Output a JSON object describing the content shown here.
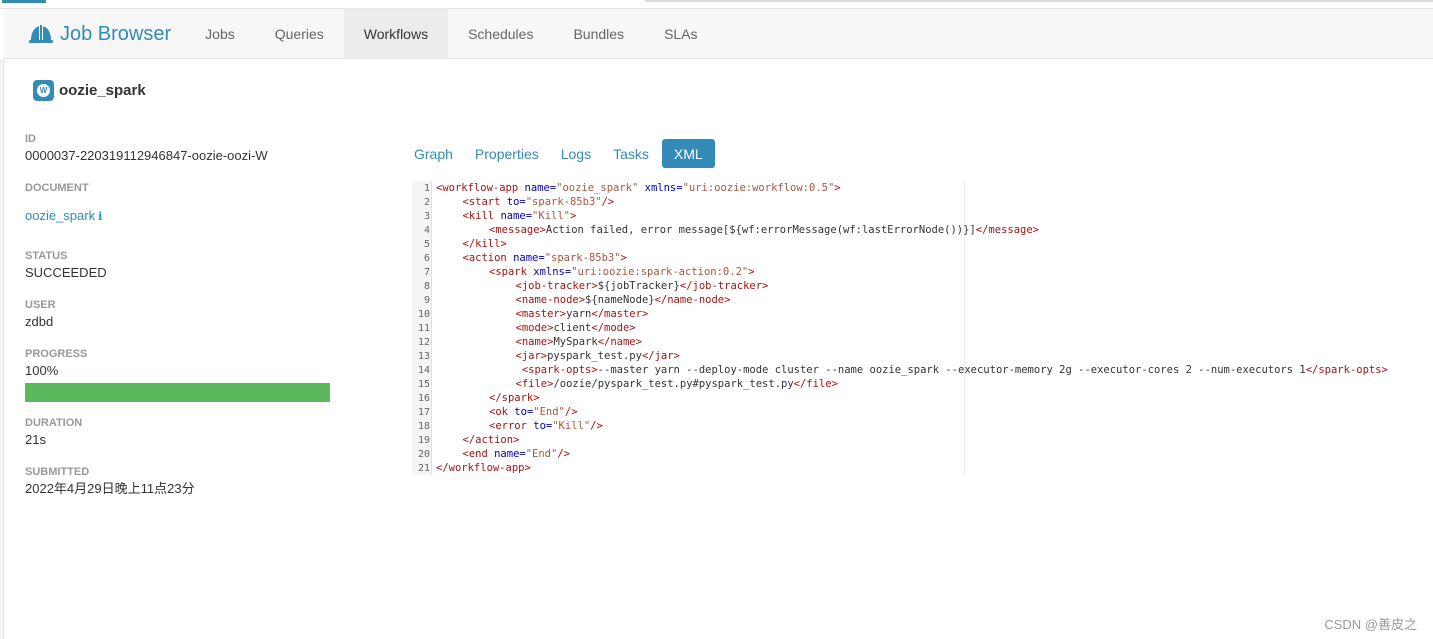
{
  "app": {
    "title": "Job Browser"
  },
  "nav": {
    "tabs": [
      {
        "label": "Jobs"
      },
      {
        "label": "Queries"
      },
      {
        "label": "Workflows",
        "active": true
      },
      {
        "label": "Schedules"
      },
      {
        "label": "Bundles"
      },
      {
        "label": "SLAs"
      }
    ]
  },
  "workflow": {
    "badge": "W",
    "name": "oozie_spark"
  },
  "details": {
    "id_label": "ID",
    "id_value": "0000037-220319112946847-oozie-oozi-W",
    "document_label": "DOCUMENT",
    "document_value": "oozie_spark",
    "status_label": "STATUS",
    "status_value": "SUCCEEDED",
    "user_label": "USER",
    "user_value": "zdbd",
    "progress_label": "PROGRESS",
    "progress_value": "100%",
    "progress_fraction": 1.0,
    "duration_label": "DURATION",
    "duration_value": "21s",
    "submitted_label": "SUBMITTED",
    "submitted_value": "2022年4月29日晚上11点23分"
  },
  "tabs": [
    {
      "label": "Graph"
    },
    {
      "label": "Properties"
    },
    {
      "label": "Logs"
    },
    {
      "label": "Tasks"
    },
    {
      "label": "XML",
      "active": true
    }
  ],
  "xml_lines": [
    {
      "n": "1",
      "indent": 0,
      "tokens": [
        [
          "tg",
          "<workflow-app "
        ],
        [
          "at",
          "name="
        ],
        [
          "st",
          "\"oozie_spark\""
        ],
        [
          "at",
          " xmlns="
        ],
        [
          "st",
          "\"uri:oozie:workflow:0.5\""
        ],
        [
          "tg",
          ">"
        ]
      ]
    },
    {
      "n": "2",
      "indent": 1,
      "tokens": [
        [
          "tg",
          "<start "
        ],
        [
          "at",
          "to="
        ],
        [
          "st",
          "\"spark-85b3\""
        ],
        [
          "tg",
          "/>"
        ]
      ]
    },
    {
      "n": "3",
      "indent": 1,
      "tokens": [
        [
          "tg",
          "<kill "
        ],
        [
          "at",
          "name="
        ],
        [
          "st",
          "\"Kill\""
        ],
        [
          "tg",
          ">"
        ]
      ]
    },
    {
      "n": "4",
      "indent": 2,
      "tokens": [
        [
          "tg",
          "<message>"
        ],
        [
          "tx",
          "Action failed, error message[${wf:errorMessage(wf:lastErrorNode())}]"
        ],
        [
          "tg",
          "</message>"
        ]
      ]
    },
    {
      "n": "5",
      "indent": 1,
      "tokens": [
        [
          "tg",
          "</kill>"
        ]
      ]
    },
    {
      "n": "6",
      "indent": 1,
      "tokens": [
        [
          "tg",
          "<action "
        ],
        [
          "at",
          "name="
        ],
        [
          "st",
          "\"spark-85b3\""
        ],
        [
          "tg",
          ">"
        ]
      ]
    },
    {
      "n": "7",
      "indent": 2,
      "tokens": [
        [
          "tg",
          "<spark "
        ],
        [
          "at",
          "xmlns="
        ],
        [
          "st",
          "\"uri:oozie:spark-action:0.2\""
        ],
        [
          "tg",
          ">"
        ]
      ]
    },
    {
      "n": "8",
      "indent": 3,
      "tokens": [
        [
          "tg",
          "<job-tracker>"
        ],
        [
          "tx",
          "${jobTracker}"
        ],
        [
          "tg",
          "</job-tracker>"
        ]
      ]
    },
    {
      "n": "9",
      "indent": 3,
      "tokens": [
        [
          "tg",
          "<name-node>"
        ],
        [
          "tx",
          "${nameNode}"
        ],
        [
          "tg",
          "</name-node>"
        ]
      ]
    },
    {
      "n": "10",
      "indent": 3,
      "tokens": [
        [
          "tg",
          "<master>"
        ],
        [
          "tx",
          "yarn"
        ],
        [
          "tg",
          "</master>"
        ]
      ]
    },
    {
      "n": "11",
      "indent": 3,
      "tokens": [
        [
          "tg",
          "<mode>"
        ],
        [
          "tx",
          "client"
        ],
        [
          "tg",
          "</mode>"
        ]
      ]
    },
    {
      "n": "12",
      "indent": 3,
      "tokens": [
        [
          "tg",
          "<name>"
        ],
        [
          "tx",
          "MySpark"
        ],
        [
          "tg",
          "</name>"
        ]
      ]
    },
    {
      "n": "13",
      "indent": 3,
      "tokens": [
        [
          "tg",
          "<jar>"
        ],
        [
          "tx",
          "pyspark_test.py"
        ],
        [
          "tg",
          "</jar>"
        ]
      ]
    },
    {
      "n": "14",
      "indent": 3,
      "tokens": [
        [
          "tg",
          " <spark-opts>"
        ],
        [
          "tx",
          "--master yarn --deploy-mode cluster --name oozie_spark --executor-memory 2g --executor-cores 2 --num-executors 1"
        ],
        [
          "tg",
          "</spark-opts>"
        ]
      ]
    },
    {
      "n": "15",
      "indent": 3,
      "tokens": [
        [
          "tg",
          "<file>"
        ],
        [
          "tx",
          "/oozie/pyspark_test.py#pyspark_test.py"
        ],
        [
          "tg",
          "</file>"
        ]
      ]
    },
    {
      "n": "16",
      "indent": 2,
      "tokens": [
        [
          "tg",
          "</spark>"
        ]
      ]
    },
    {
      "n": "17",
      "indent": 2,
      "tokens": [
        [
          "tg",
          "<ok "
        ],
        [
          "at",
          "to="
        ],
        [
          "st",
          "\"End\""
        ],
        [
          "tg",
          "/>"
        ]
      ]
    },
    {
      "n": "18",
      "indent": 2,
      "tokens": [
        [
          "tg",
          "<error "
        ],
        [
          "at",
          "to="
        ],
        [
          "st",
          "\"Kill\""
        ],
        [
          "tg",
          "/>"
        ]
      ]
    },
    {
      "n": "19",
      "indent": 1,
      "tokens": [
        [
          "tg",
          "</action>"
        ]
      ]
    },
    {
      "n": "20",
      "indent": 1,
      "tokens": [
        [
          "tg",
          "<end "
        ],
        [
          "at",
          "name="
        ],
        [
          "st",
          "\"End\""
        ],
        [
          "tg",
          "/>"
        ]
      ]
    },
    {
      "n": "21",
      "indent": 0,
      "tokens": [
        [
          "tg",
          "</workflow-app>"
        ]
      ]
    }
  ],
  "watermark": "CSDN @善皮之",
  "icons": {
    "brand": "hardhat-icon",
    "info": "info-icon"
  },
  "colors": {
    "accent": "#338bb8",
    "progress": "#5cb85c"
  }
}
